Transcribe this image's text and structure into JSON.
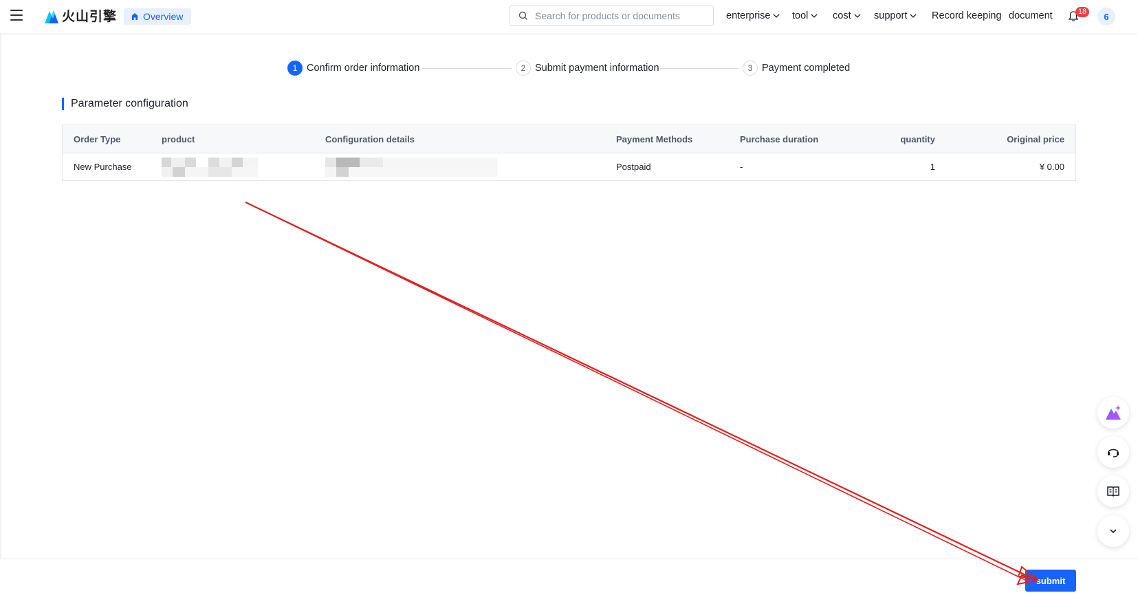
{
  "header": {
    "logo_text": "火山引擎",
    "overview_label": "Overview",
    "search_placeholder": "Search for products or documents",
    "nav": {
      "enterprise": "enterprise",
      "tool": "tool",
      "cost": "cost",
      "support": "support",
      "record_keeping": "Record keeping",
      "document": "document"
    },
    "notification_count": "18",
    "avatar_text": "6"
  },
  "steps": [
    {
      "num": "1",
      "label": "Confirm order information"
    },
    {
      "num": "2",
      "label": "Submit payment information"
    },
    {
      "num": "3",
      "label": "Payment completed"
    }
  ],
  "section": {
    "title": "Parameter configuration"
  },
  "table": {
    "headers": [
      "Order Type",
      "product",
      "Configuration details",
      "Payment Methods",
      "Purchase duration",
      "quantity",
      "Original price"
    ],
    "rows": [
      {
        "order_type": "New Purchase",
        "payment_method": "Postpaid",
        "duration": "-",
        "quantity": "1",
        "price": "¥ 0.00"
      }
    ]
  },
  "footer": {
    "submit_label": "submit"
  },
  "colors": {
    "accent": "#1664ff",
    "badge": "#f53f3f",
    "annotation_arrow": "#e02020"
  },
  "icons": [
    "menu-icon",
    "logo-icon",
    "home-icon",
    "search-icon",
    "chevron-down-icon",
    "bell-icon",
    "ai-assistant-icon",
    "customer-service-icon",
    "book-icon",
    "chevron-down-icon"
  ]
}
